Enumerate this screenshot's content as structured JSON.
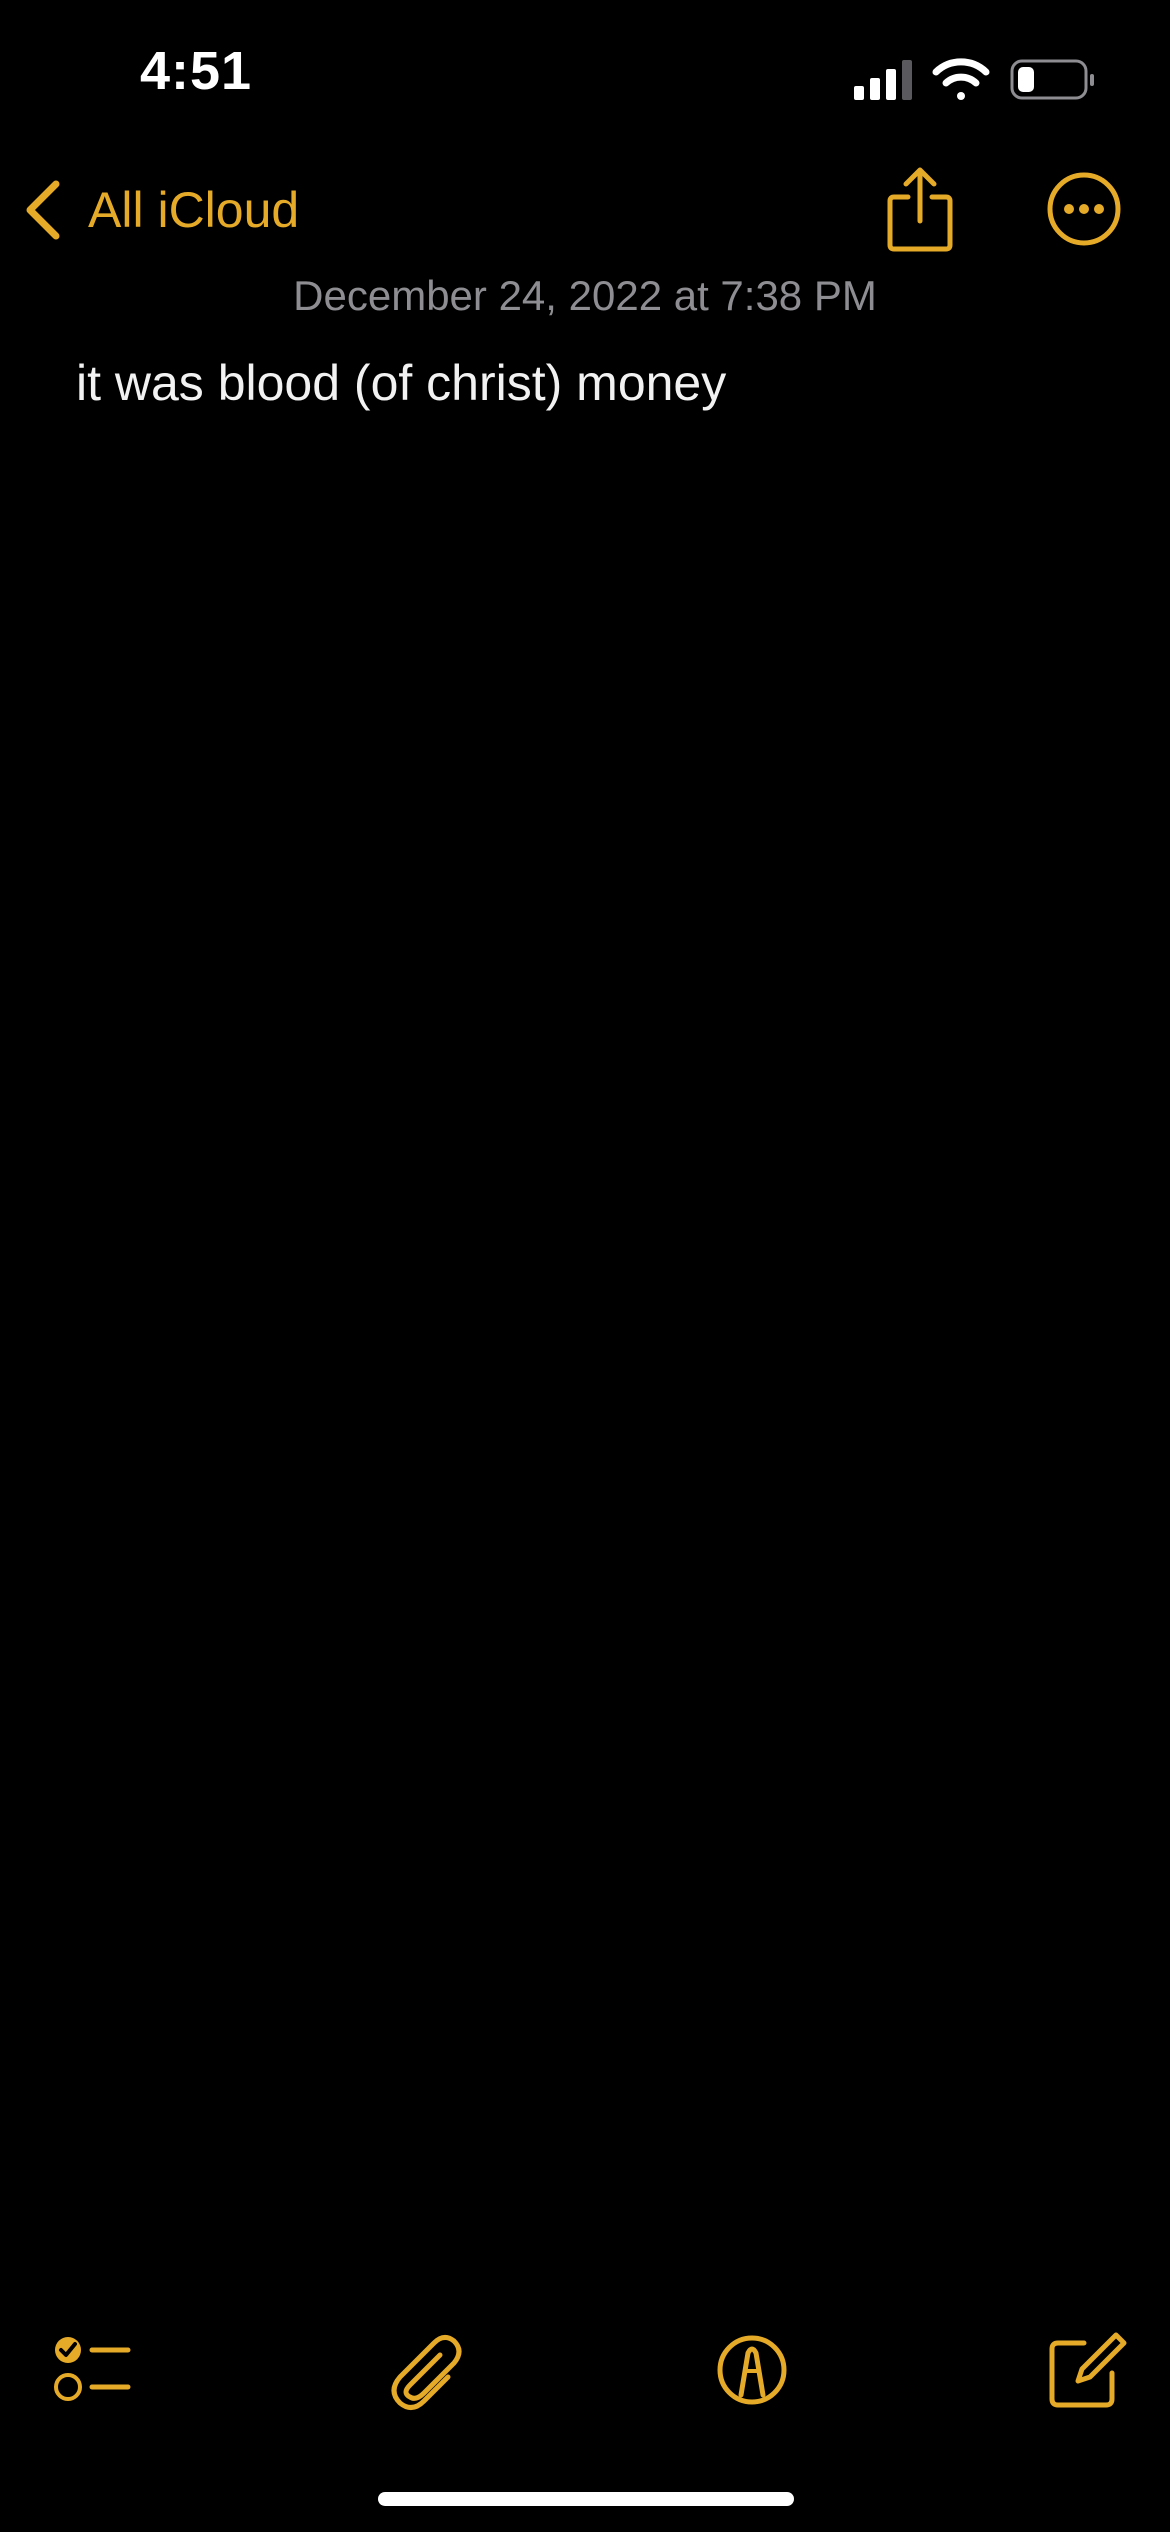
{
  "status_bar": {
    "time": "4:51"
  },
  "nav": {
    "back_label": "All iCloud"
  },
  "note": {
    "date": "December 24, 2022 at 7:38 PM",
    "body": "it was blood (of christ) money"
  },
  "icons": {
    "signal": "cellular-signal-icon",
    "wifi": "wifi-icon",
    "battery": "battery-icon",
    "back": "chevron-left-icon",
    "share": "share-icon",
    "more": "ellipsis-circle-icon",
    "checklist": "checklist-icon",
    "attach": "paperclip-icon",
    "markup": "markup-pen-icon",
    "compose": "compose-icon"
  },
  "colors": {
    "accent": "#e6aa29",
    "background": "#000000",
    "text": "#f2f2f2",
    "secondary_text": "#8d8d92"
  }
}
